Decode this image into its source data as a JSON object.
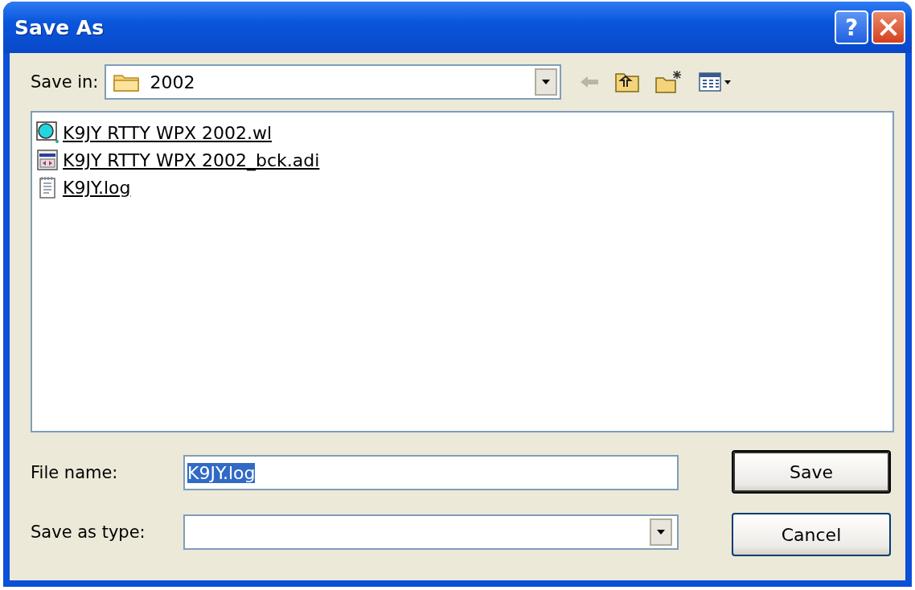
{
  "window": {
    "title": "Save As",
    "buttons": [
      "?"
    ]
  },
  "save_in": {
    "label": "Save in:",
    "value": "2002"
  },
  "files": [
    {
      "name": "K9JY RTTY WPX 2002.wl",
      "kind": "wl"
    },
    {
      "name": "K9JY RTTY WPX 2002_bck.adi",
      "kind": "adi"
    },
    {
      "name": "K9JY.log",
      "kind": "log"
    }
  ],
  "file_name": {
    "label": "File name:",
    "value": "K9JY.log",
    "text_selected": true
  },
  "save_as_type": {
    "label": "Save as type:"
  },
  "buttons": [
    {
      "label": "Save",
      "default": true
    },
    {
      "label": "Cancel",
      "default": false
    }
  ]
}
